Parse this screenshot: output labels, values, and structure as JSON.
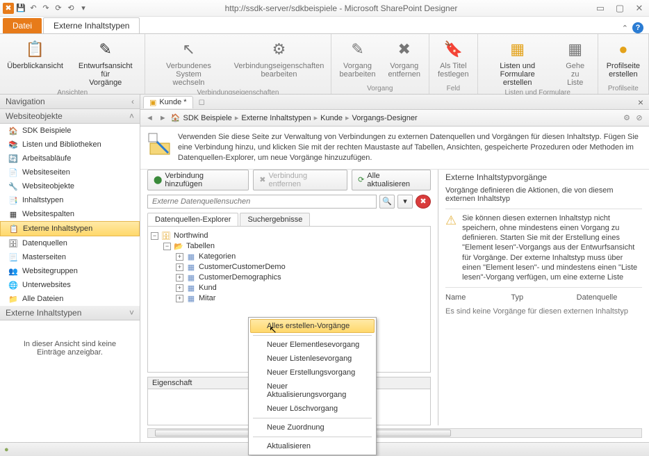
{
  "title": "http://ssdk-server/sdkbeispiele - Microsoft SharePoint Designer",
  "tabs": {
    "file": "Datei",
    "active": "Externe Inhaltstypen"
  },
  "ribbon": {
    "groups": [
      {
        "label": "Ansichten",
        "items": [
          {
            "name": "overview",
            "label": "Überblickansicht",
            "enabled": true
          },
          {
            "name": "design-view",
            "label": "Entwurfsansicht für\nVorgänge",
            "enabled": true
          }
        ]
      },
      {
        "label": "Verbindungseigenschaften",
        "items": [
          {
            "name": "switch-system",
            "label": "Verbundenes System\nwechseln",
            "enabled": false
          },
          {
            "name": "edit-conn-props",
            "label": "Verbindungseigenschaften\nbearbeiten",
            "enabled": false
          }
        ]
      },
      {
        "label": "Vorgang",
        "items": [
          {
            "name": "edit-op",
            "label": "Vorgang\nbearbeiten",
            "enabled": false
          },
          {
            "name": "remove-op",
            "label": "Vorgang\nentfernen",
            "enabled": false
          }
        ]
      },
      {
        "label": "Feld",
        "items": [
          {
            "name": "set-title",
            "label": "Als Titel\nfestlegen",
            "enabled": false
          }
        ]
      },
      {
        "label": "Listen und Formulare",
        "items": [
          {
            "name": "create-lists",
            "label": "Listen und\nFormulare erstellen",
            "enabled": true
          },
          {
            "name": "goto-list",
            "label": "Gehe zu\nListe",
            "enabled": false
          }
        ]
      },
      {
        "label": "Profilseite",
        "items": [
          {
            "name": "create-profile",
            "label": "Profilseite\nerstellen",
            "enabled": true
          }
        ]
      }
    ]
  },
  "nav": {
    "header": "Navigation",
    "section": "Websiteobjekte",
    "items": [
      {
        "id": "home",
        "label": "SDK Beispiele",
        "icon": "🏠"
      },
      {
        "id": "lists",
        "label": "Listen und Bibliotheken",
        "icon": "📚"
      },
      {
        "id": "workflows",
        "label": "Arbeitsabläufe",
        "icon": "🔄"
      },
      {
        "id": "pages",
        "label": "Websiteseiten",
        "icon": "📄"
      },
      {
        "id": "objects",
        "label": "Websiteobjekte",
        "icon": "🔧"
      },
      {
        "id": "contenttypes",
        "label": "Inhaltstypen",
        "icon": "📑"
      },
      {
        "id": "columns",
        "label": "Websitespalten",
        "icon": "▦"
      },
      {
        "id": "ect",
        "label": "Externe Inhaltstypen",
        "icon": "📋",
        "selected": true
      },
      {
        "id": "datasources",
        "label": "Datenquellen",
        "icon": "🗄"
      },
      {
        "id": "masterpages",
        "label": "Masterseiten",
        "icon": "📃"
      },
      {
        "id": "sitegroups",
        "label": "Websitegruppen",
        "icon": "👥"
      },
      {
        "id": "subsites",
        "label": "Unterwebsites",
        "icon": "🌐"
      },
      {
        "id": "allfiles",
        "label": "Alle Dateien",
        "icon": "📁"
      }
    ],
    "lower_header": "Externe Inhaltstypen",
    "empty": "In dieser Ansicht sind keine Einträge anzeigbar."
  },
  "doc": {
    "tab_label": "Kunde *"
  },
  "breadcrumb": {
    "items": [
      "SDK Beispiele",
      "Externe Inhaltstypen",
      "Kunde",
      "Vorgangs-Designer"
    ]
  },
  "info": "Verwenden Sie diese Seite zur Verwaltung von Verbindungen zu externen Datenquellen und Vorgängen für diesen Inhaltstyp. Fügen Sie eine Verbindung hinzu, und klicken Sie mit der rechten Maustaste auf Tabellen, Ansichten, gespeicherte Prozeduren oder Methoden im Datenquellen-Explorer, um neue Vorgänge hinzuzufügen.",
  "toolbar": {
    "add_conn": "Verbindung hinzufügen",
    "remove_conn": "Verbindung entfernen",
    "refresh_all": "Alle aktualisieren"
  },
  "search": {
    "placeholder": "Externe Datenquellensuchen"
  },
  "inner_tabs": {
    "explorer": "Datenquellen-Explorer",
    "results": "Suchergebnisse"
  },
  "tree": {
    "root": "Northwind",
    "folder": "Tabellen",
    "tables": [
      "Kategorien",
      "CustomerCustomerDemo",
      "CustomerDemographics",
      "Kund",
      "Mitar"
    ]
  },
  "property": {
    "header": "Eigenschaft"
  },
  "ops": {
    "title": "Externe Inhaltstypvorgänge",
    "desc": "Vorgänge definieren die Aktionen, die von diesem externen Inhaltstyp",
    "warning": "Sie können diesen externen Inhaltstyp nicht speichern, ohne mindestens einen Vorgang zu definieren. Starten Sie mit der Erstellung eines \"Element lesen\"-Vorgangs aus der Entwurfsansicht für Vorgänge. Der externe Inhaltstyp muss über einen \"Element lesen\"- und mindestens einen \"Liste lesen\"-Vorgang verfügen, um eine externe Liste",
    "cols": {
      "name": "Name",
      "type": "Typ",
      "ds": "Datenquelle"
    },
    "empty": "Es sind keine Vorgänge für diesen externen Inhaltstyp"
  },
  "ctx": {
    "items": [
      "Alles erstellen-Vorgänge",
      "Neuer Elementlesevorgang",
      "Neuer Listenlesevorgang",
      "Neuer Erstellungsvorgang",
      "Neuer Aktualisierungsvorgang",
      "Neuer Löschvorgang",
      "Neue Zuordnung",
      "Aktualisieren"
    ]
  }
}
